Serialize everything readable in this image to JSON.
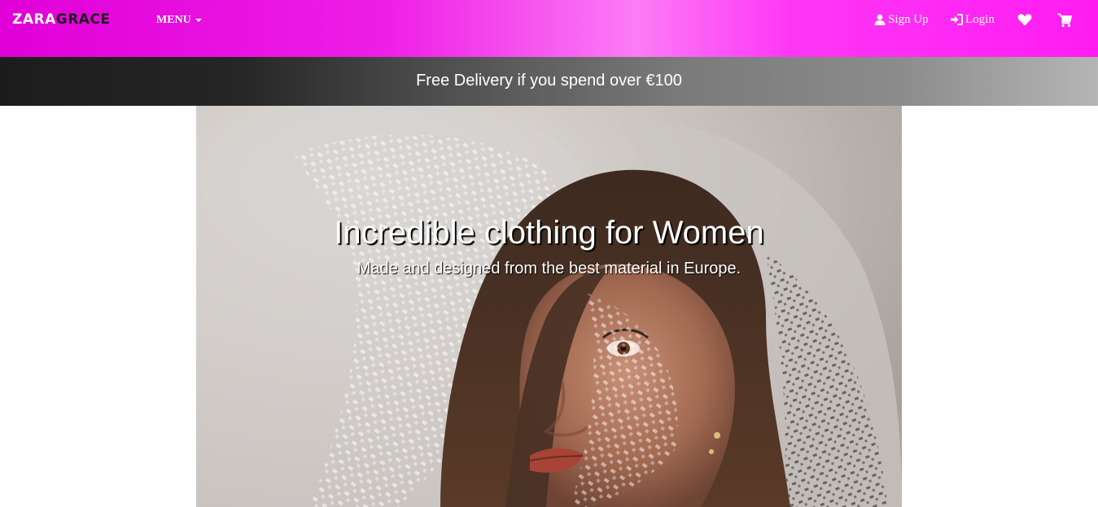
{
  "header": {
    "brand_part1": "ZARA",
    "brand_part2": "GRACE",
    "menu_label": "MENU",
    "signup_label": "Sign Up",
    "login_label": "Login",
    "icons": [
      "user-icon",
      "login-icon",
      "heart-icon",
      "cart-icon"
    ],
    "colors": {
      "gradient_start": "#e000d8",
      "gradient_end": "#ff1cf2"
    }
  },
  "promo": {
    "text": "Free Delivery if you spend over €100"
  },
  "hero": {
    "title": "Incredible clothing for Women",
    "subtitle": "Made and designed from the best material in Europe."
  }
}
